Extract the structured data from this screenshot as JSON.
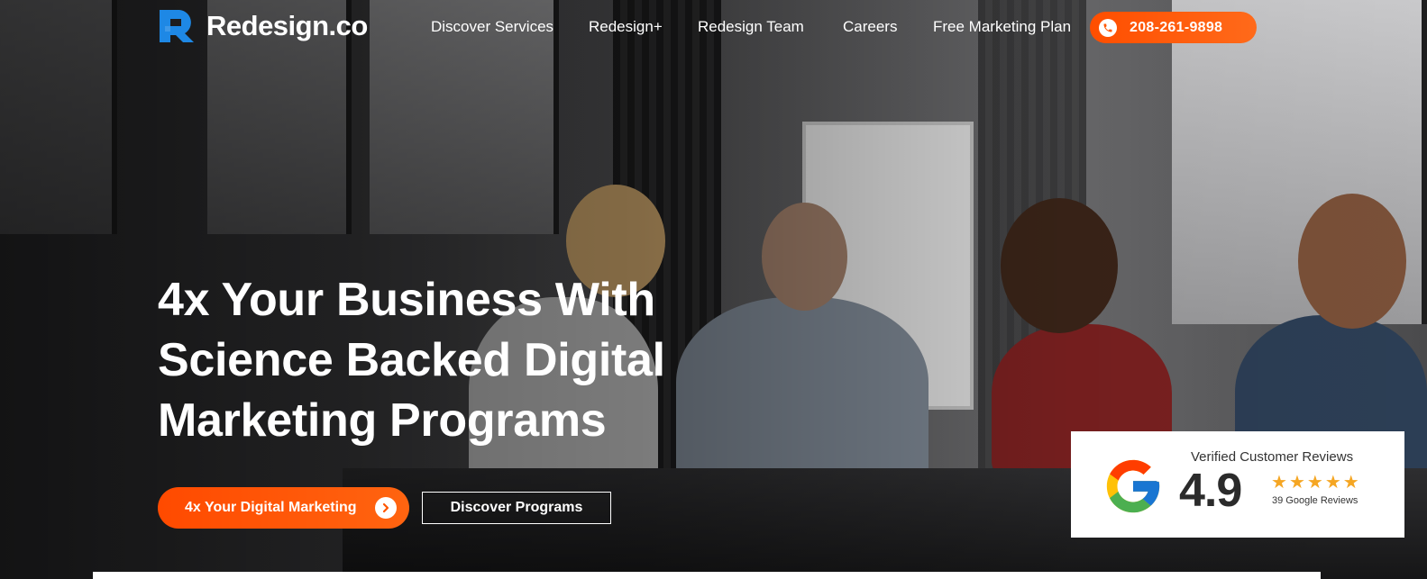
{
  "brand": {
    "logo_text": "Redesign.co",
    "logo_icon": "redesign-r-logo-icon",
    "accent_color": "#ff5500",
    "logo_color": "#1e88e5"
  },
  "nav": {
    "links": [
      {
        "label": "Discover Services"
      },
      {
        "label": "Redesign+"
      },
      {
        "label": "Redesign Team"
      },
      {
        "label": "Careers"
      },
      {
        "label": "Free Marketing Plan"
      }
    ],
    "phone": {
      "label": "208-261-9898",
      "icon": "phone-icon"
    }
  },
  "hero": {
    "headline_lines": [
      "4x Your Business With",
      "Science Backed Digital",
      "Marketing Programs"
    ],
    "primary_cta": {
      "label": "4x Your Digital Marketing",
      "icon": "chevron-right-icon"
    },
    "secondary_cta": {
      "label": "Discover Programs"
    }
  },
  "reviews": {
    "title": "Verified Customer Reviews",
    "score": "4.9",
    "stars": 5,
    "count_label": "39 Google Reviews",
    "icon": "google-g-icon"
  }
}
